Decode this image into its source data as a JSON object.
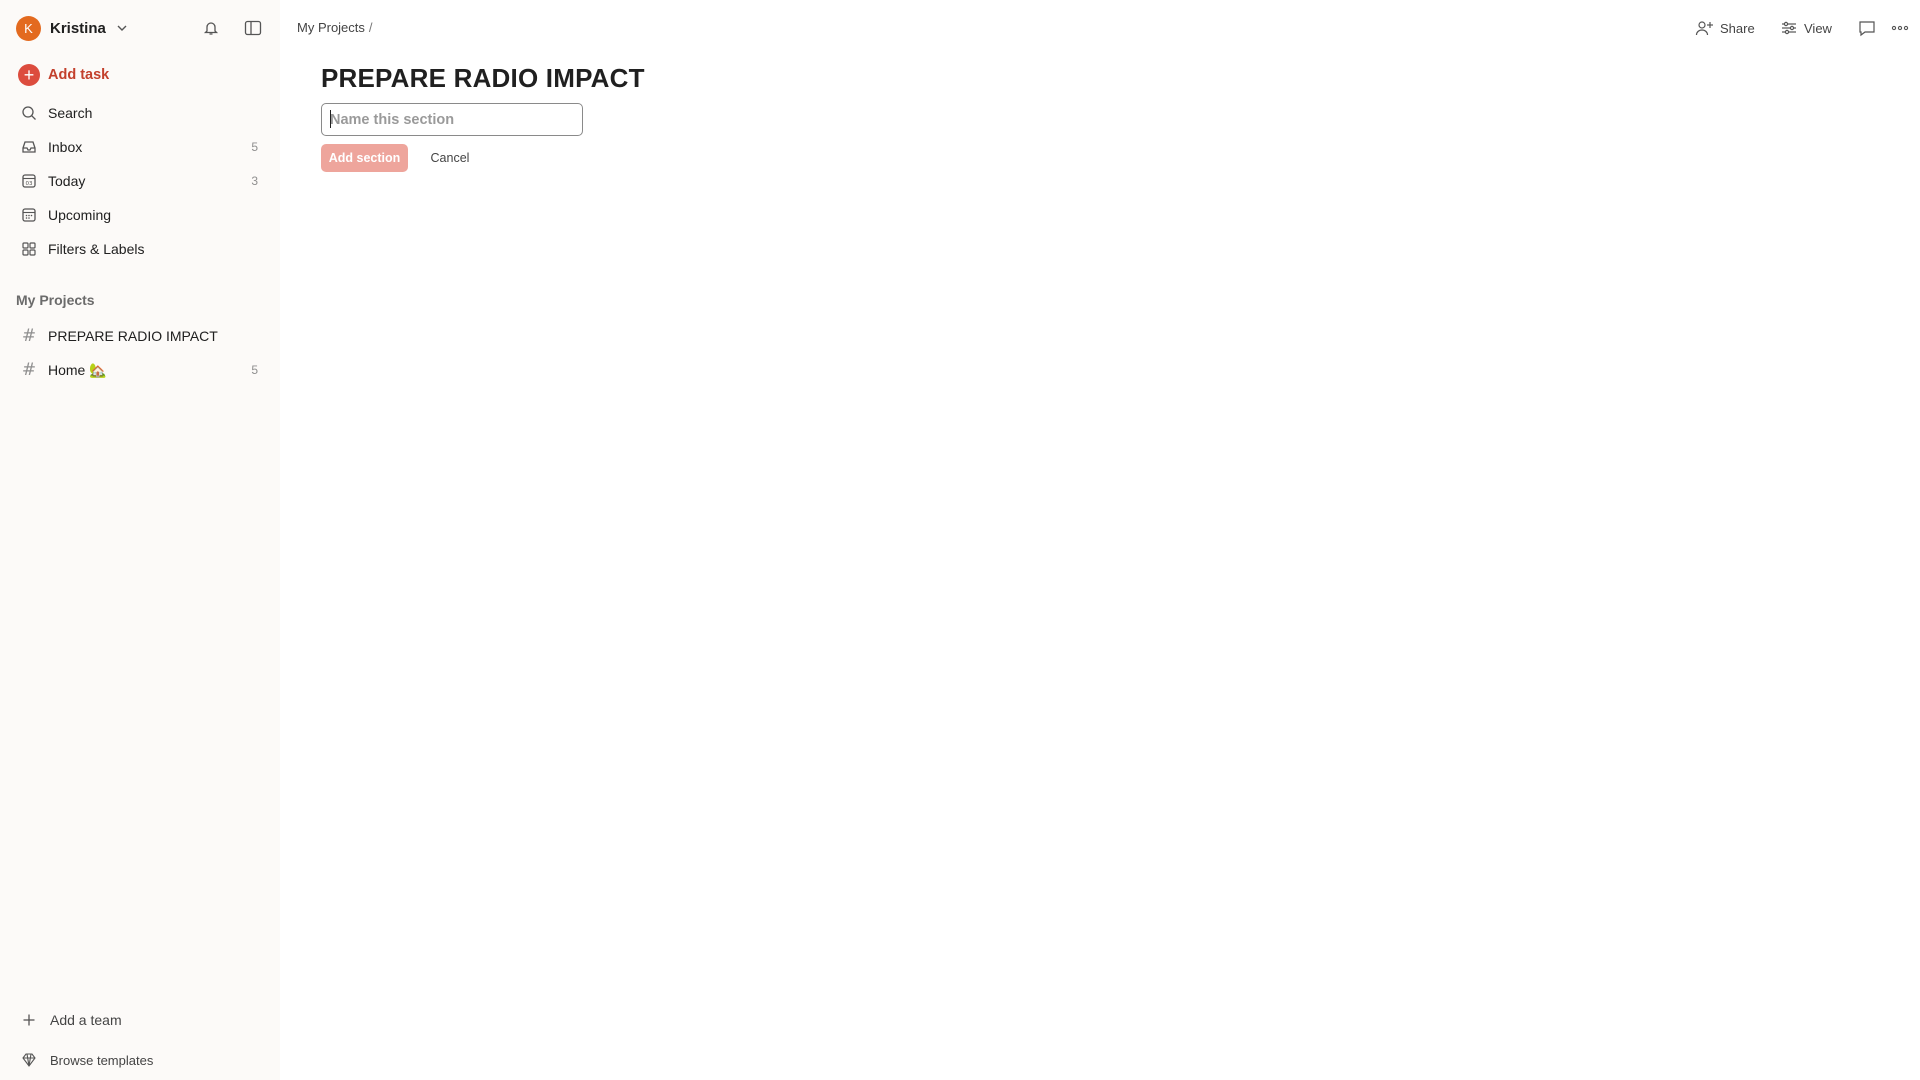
{
  "sidebar": {
    "user": {
      "initial": "K",
      "name": "Kristina"
    },
    "add_task_label": "Add task",
    "nav": [
      {
        "label": "Search",
        "icon": "search-icon",
        "count": ""
      },
      {
        "label": "Inbox",
        "icon": "inbox-icon",
        "count": "5"
      },
      {
        "label": "Today",
        "icon": "calendar-today-icon",
        "count": "3"
      },
      {
        "label": "Upcoming",
        "icon": "calendar-upcoming-icon",
        "count": ""
      },
      {
        "label": "Filters & Labels",
        "icon": "grid-icon",
        "count": ""
      }
    ],
    "projects_title": "My Projects",
    "projects": [
      {
        "label": "PREPARE RADIO IMPACT",
        "count": ""
      },
      {
        "label": "Home 🏡",
        "count": "5"
      }
    ],
    "add_team_label": "Add a team",
    "browse_templates_label": "Browse templates"
  },
  "topbar": {
    "breadcrumb": "My Projects",
    "breadcrumb_sep": "/",
    "share_label": "Share",
    "view_label": "View"
  },
  "main": {
    "project_title": "PREPARE RADIO IMPACT",
    "section_placeholder": "Name this section",
    "add_section_label": "Add section",
    "cancel_label": "Cancel"
  },
  "colors": {
    "accent": "#dc4c3e",
    "accent_text": "#c3402c",
    "avatar": "#e36a1f",
    "disabled_button": "#eea59c",
    "sidebar_bg": "#fcfaf8"
  }
}
